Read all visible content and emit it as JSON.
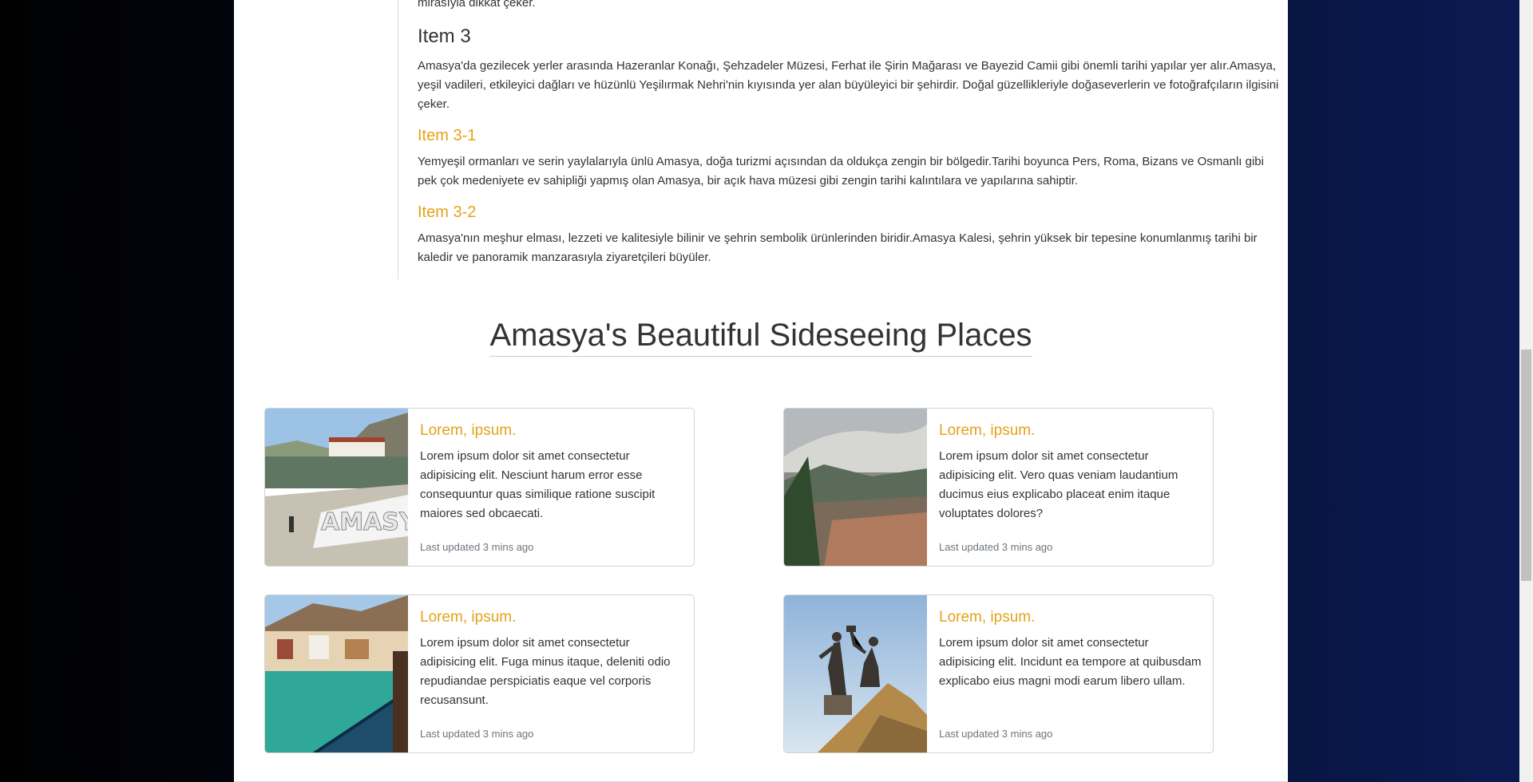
{
  "article": {
    "tail_text": "mirasıyla dikkat çeker.",
    "items": [
      {
        "title": "Item 3",
        "text": "Amasya'da gezilecek yerler arasında Hazeranlar Konağı, Şehzadeler Müzesi, Ferhat ile Şirin Mağarası ve Bayezid Camii gibi önemli tarihi yapılar yer alır.Amasya, yeşil vadileri, etkileyici dağları ve hüzünlü Yeşilırmak Nehri'nin kıyısında yer alan büyüleyici bir şehirdir. Doğal güzellikleriyle doğaseverlerin ve fotoğrafçıların ilgisini çeker."
      },
      {
        "title": "Item 3-1",
        "text": "Yemyeşil ormanları ve serin yaylalarıyla ünlü Amasya, doğa turizmi açısından da oldukça zengin bir bölgedir.Tarihi boyunca Pers, Roma, Bizans ve Osmanlı gibi pek çok medeniyete ev sahipliği yapmış olan Amasya, bir açık hava müzesi gibi zengin tarihi kalıntılara ve yapılarına sahiptir."
      },
      {
        "title": "Item 3-2",
        "text": "Amasya'nın meşhur elması, lezzeti ve kalitesiyle bilinir ve şehrin sembolik ürünlerinden biridir.Amasya Kalesi, şehrin yüksek bir tepesine konumlanmış tarihi bir kaledir ve panoramik manzarasıyla ziyaretçileri büyüler."
      }
    ]
  },
  "section_title": "Amasya's Beautiful Sideseeing Places",
  "cards": [
    {
      "title": "Lorem, ipsum.",
      "text": "Lorem ipsum dolor sit amet consectetur adipisicing elit. Nesciunt harum error esse consequuntur quas similique ratione suscipit maiores sed obcaecati.",
      "updated": "Last updated 3 mins ago",
      "image": "amasya-sign-riverside-photo"
    },
    {
      "title": "Lorem, ipsum.",
      "text": "Lorem ipsum dolor sit amet consectetur adipisicing elit. Vero quas veniam laudantium ducimus eius explicabo placeat enim itaque voluptates dolores?",
      "updated": "Last updated 3 mins ago",
      "image": "mountain-valley-city-photo"
    },
    {
      "title": "Lorem, ipsum.",
      "text": "Lorem ipsum dolor sit amet consectetur adipisicing elit. Fuga minus itaque, deleniti odio repudiandae perspiciatis eaque vel corporis recusansunt.",
      "updated": "Last updated 3 mins ago",
      "image": "yesilirmak-river-houses-photo"
    },
    {
      "title": "Lorem, ipsum.",
      "text": "Lorem ipsum dolor sit amet consectetur adipisicing elit. Incidunt ea tempore at quibusdam explicabo eius magni modi earum libero ullam.",
      "updated": "Last updated 3 mins ago",
      "image": "ferhat-sirin-statue-photo"
    }
  ]
}
